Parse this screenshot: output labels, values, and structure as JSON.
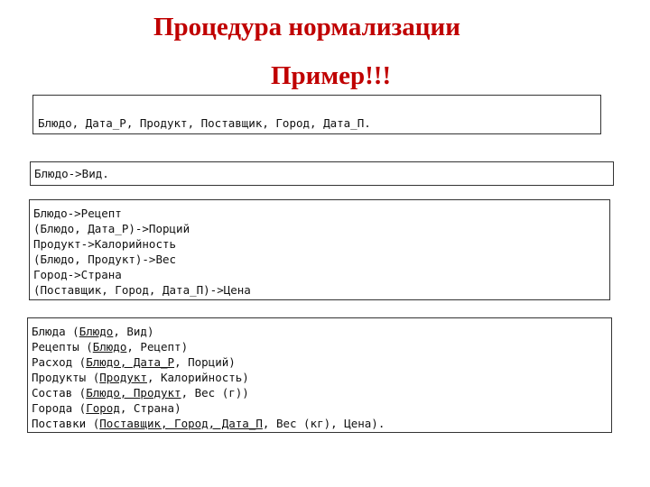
{
  "slide": {
    "title": "Процедура нормализации",
    "subtitle": "Пример!!!",
    "colors": {
      "title": "#c00000"
    }
  },
  "attributes_box": {
    "parts": [
      "Блюдо, Дата_Р, Продукт, Поставщик, Город, Дата_П."
    ]
  },
  "mvd_box": {
    "lines": [
      "Блюдо->Вид."
    ]
  },
  "fd_box": {
    "lines": [
      "Блюдо->Рецепт",
      "(Блюдо, Дата_Р)->Порций",
      "Продукт->Калорийность",
      "(Блюдо, Продукт)->Вес",
      "Город->Страна",
      "(Поставщик, Город, Дата_П)->Цена"
    ]
  },
  "relations_box": {
    "lines": [
      {
        "pre": "Блюда (",
        "key": "Блюдо",
        "post": ", Вид)"
      },
      {
        "pre": "Рецепты (",
        "key": "Блюдо",
        "post": ", Рецепт)"
      },
      {
        "pre": "Расход (",
        "key": "Блюдо, Дата_Р",
        "post": ", Порций)"
      },
      {
        "pre": "Продукты (",
        "key": "Продукт",
        "post": ", Калорийность)"
      },
      {
        "pre": "Состав (",
        "key": "Блюдо, Продукт",
        "post": ", Вес (г))"
      },
      {
        "pre": "Города (",
        "key": "Город",
        "post": ", Страна)"
      },
      {
        "pre": "Поставки (",
        "key": "Поставщик, Город, Дата_П",
        "post": ", Вес (кг), Цена)."
      }
    ]
  }
}
